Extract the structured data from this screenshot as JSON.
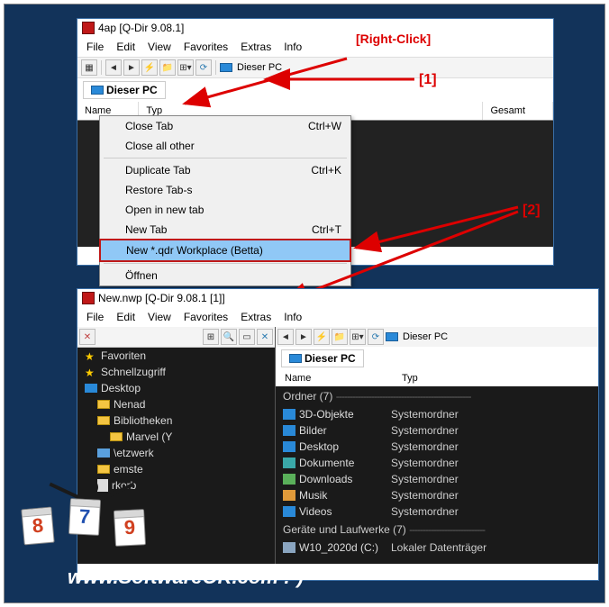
{
  "annotations": {
    "right_click": "[Right-Click]",
    "marker1": "[1]",
    "marker2": "[2]"
  },
  "window1": {
    "title": "4ap  [Q-Dir 9.08.1]",
    "menu": [
      "File",
      "Edit",
      "View",
      "Favorites",
      "Extras",
      "Info"
    ],
    "address": "Dieser PC",
    "tab": "Dieser PC",
    "columns": [
      "Name",
      "Typ",
      "Gesamt"
    ]
  },
  "context_menu": {
    "items": [
      {
        "label": "Close Tab",
        "shortcut": "Ctrl+W"
      },
      {
        "label": "Close all other",
        "shortcut": ""
      },
      {
        "sep": true
      },
      {
        "label": "Duplicate Tab",
        "shortcut": "Ctrl+K"
      },
      {
        "label": "Restore Tab-s",
        "shortcut": ""
      },
      {
        "label": "Open in new tab",
        "shortcut": ""
      },
      {
        "label": "New Tab",
        "shortcut": "Ctrl+T"
      },
      {
        "label": "New *.qdr Workplace (Betta)",
        "shortcut": "",
        "highlight": true
      },
      {
        "sep": true
      },
      {
        "label": "Öffnen",
        "shortcut": ""
      }
    ]
  },
  "window2": {
    "title": "New.nwp  [Q-Dir 9.08.1 [1]]",
    "menu": [
      "File",
      "Edit",
      "View",
      "Favorites",
      "Extras",
      "Info"
    ],
    "tree": [
      {
        "label": "Favoriten",
        "icon": "star",
        "indent": 0
      },
      {
        "label": "Schnellzugriff",
        "icon": "star",
        "indent": 0
      },
      {
        "label": "Desktop",
        "icon": "desktop",
        "indent": 0
      },
      {
        "label": "Nenad",
        "icon": "folder",
        "indent": 1
      },
      {
        "label": "Bibliotheken",
        "icon": "folder",
        "indent": 1
      },
      {
        "label": "Marvel (Y",
        "icon": "folder",
        "indent": 2
      },
      {
        "label": "\\etzwerk",
        "icon": "net",
        "indent": 1
      },
      {
        "label": "emste",
        "icon": "folder",
        "indent": 1
      },
      {
        "label": "rkorb",
        "icon": "bin",
        "indent": 1
      }
    ],
    "address": "Dieser PC",
    "tab": "Dieser PC",
    "columns": [
      "Name",
      "Typ"
    ],
    "group1": {
      "title": "Ordner (7)",
      "items": [
        {
          "name": "3D-Objekte",
          "type": "Systemordner",
          "icon": "blue"
        },
        {
          "name": "Bilder",
          "type": "Systemordner",
          "icon": "blue"
        },
        {
          "name": "Desktop",
          "type": "Systemordner",
          "icon": "blue"
        },
        {
          "name": "Dokumente",
          "type": "Systemordner",
          "icon": "teal"
        },
        {
          "name": "Downloads",
          "type": "Systemordner",
          "icon": "green"
        },
        {
          "name": "Musik",
          "type": "Systemordner",
          "icon": "orange"
        },
        {
          "name": "Videos",
          "type": "Systemordner",
          "icon": "blue"
        }
      ]
    },
    "group2": {
      "title": "Geräte und Laufwerke (7)",
      "items": [
        {
          "name": "W10_2020d (C:)",
          "type": "Lokaler Datenträger",
          "icon": "drive"
        }
      ]
    }
  },
  "watermark": "www.SoftwareOK.com :-)",
  "calendar": [
    "8",
    "7",
    "9"
  ]
}
